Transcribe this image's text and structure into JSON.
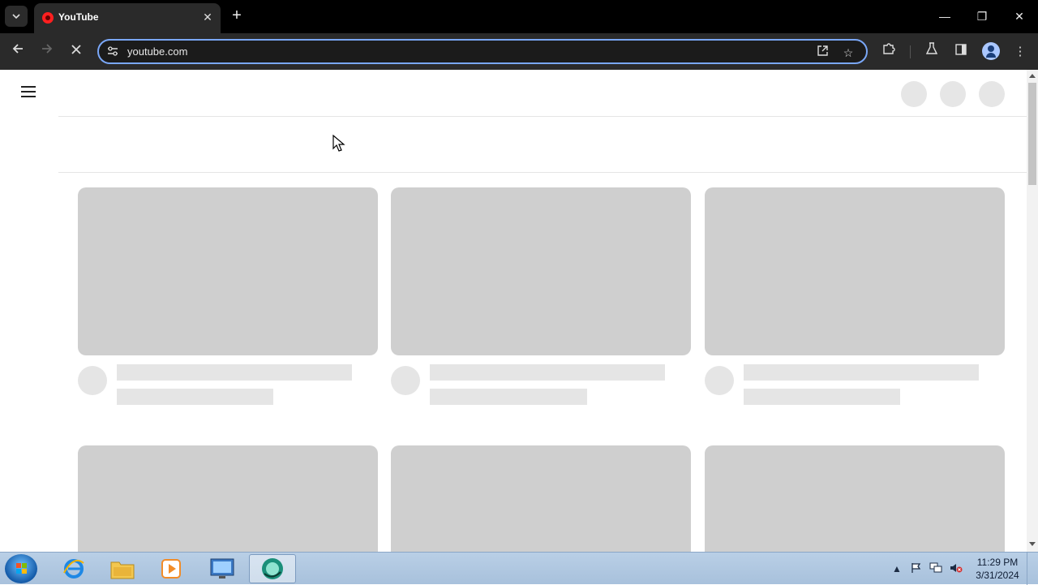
{
  "browser": {
    "tab_title": "YouTube",
    "url": "youtube.com"
  },
  "taskbar": {
    "time": "11:29 PM",
    "date": "3/31/2024"
  },
  "colors": {
    "omnibox_focus": "#7aa7f7",
    "skeleton_thumb": "#cfcfcf",
    "skeleton_line": "#e5e5e5"
  },
  "icons": {
    "tab_search": "chevron-down-icon",
    "favicon": "youtube-favicon-icon",
    "close": "close-icon",
    "new_tab": "plus-icon",
    "back": "arrow-left-icon",
    "forward": "arrow-right-icon",
    "stop": "x-stop-icon",
    "site_info": "tune-icon",
    "open_in_app": "open-external-icon",
    "bookmark": "star-icon",
    "extensions": "puzzle-icon",
    "labs": "flask-icon",
    "side_panel": "side-panel-icon",
    "profile": "profile-icon",
    "menu": "kebab-menu-icon"
  }
}
